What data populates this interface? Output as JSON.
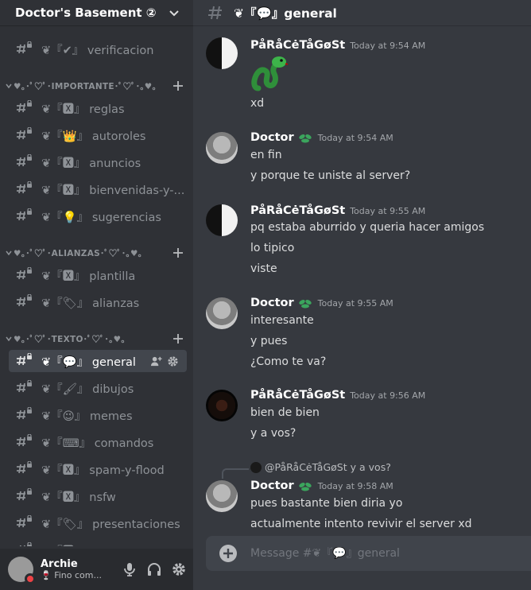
{
  "server": {
    "name": "Doctor's Basement ②"
  },
  "channels": [
    {
      "prefix": "❦『✔』",
      "name": "verificacion"
    },
    {
      "prefix": "❦『🆇』",
      "name": "reglas"
    },
    {
      "prefix": "❦『👑』",
      "name": "autoroles"
    },
    {
      "prefix": "❦『🆇』",
      "name": "anuncios"
    },
    {
      "prefix": "❦『🆇』",
      "name": "bienvenidas-y-..."
    },
    {
      "prefix": "❦『💡』",
      "name": "sugerencias"
    },
    {
      "prefix": "❦『🆇』",
      "name": "plantilla"
    },
    {
      "prefix": "❦『🏷』",
      "name": "alianzas"
    },
    {
      "prefix": "❦『💬』",
      "name": "general"
    },
    {
      "prefix": "❦『🖌』",
      "name": "dibujos"
    },
    {
      "prefix": "❦『😉』",
      "name": "memes"
    },
    {
      "prefix": "❦『⌨』",
      "name": "comandos"
    },
    {
      "prefix": "❦『🆇』",
      "name": "spam-y-flood"
    },
    {
      "prefix": "❦『🆇』",
      "name": "nsfw"
    },
    {
      "prefix": "❦『🏷』",
      "name": "presentaciones"
    },
    {
      "prefix": "❦『🆇』",
      "name": "..."
    }
  ],
  "categories": [
    {
      "label": "♥｡･ﾟ♡ﾟ･IMPORTANTE･ﾟ♡ﾟ･｡♥｡"
    },
    {
      "label": "♥｡･ﾟ♡ﾟ･ALIANZAS･ﾟ♡ﾟ･｡♥｡"
    },
    {
      "label": "♥｡･ﾟ♡ﾟ･TEXTO･ﾟ♡ﾟ･｡♥｡"
    }
  ],
  "user": {
    "name": "Archie",
    "status": "🍷 Fino com..."
  },
  "main": {
    "channel_title": "❦『💬』general"
  },
  "messages": {
    "m1": {
      "author": "PåRåCėTåGøSt",
      "time": "Today at 9:54 AM",
      "lines": [
        "xd"
      ]
    },
    "m2": {
      "author": "Doctor",
      "time": "Today at 9:54 AM",
      "lines": [
        "en fin",
        "y porque te uniste al server?"
      ]
    },
    "m3": {
      "author": "PåRåCėTåGøSt",
      "time": "Today at 9:55 AM",
      "lines": [
        "pq estaba aburrido y queria hacer amigos",
        "lo tipico",
        "viste"
      ]
    },
    "m4": {
      "author": "Doctor",
      "time": "Today at 9:55 AM",
      "lines": [
        "interesante",
        "y pues",
        "¿Como te va?"
      ]
    },
    "m5": {
      "author": "PåRåCėTåGøSt",
      "time": "Today at 9:56 AM",
      "lines": [
        "bien de bien",
        "y a vos?"
      ]
    },
    "m6": {
      "author": "Doctor",
      "time": "Today at 9:58 AM",
      "reply_to": "@PåRåCėTåGøSt",
      "reply_text": "y a vos?",
      "lines": [
        "pues bastante bien diria yo",
        "actualmente intento revivir el server xd"
      ]
    }
  },
  "composer": {
    "placeholder": "Message #❦『💬』general"
  },
  "colors": {
    "accent_green": "#3ba55d",
    "dnd_red": "#ed4245"
  }
}
